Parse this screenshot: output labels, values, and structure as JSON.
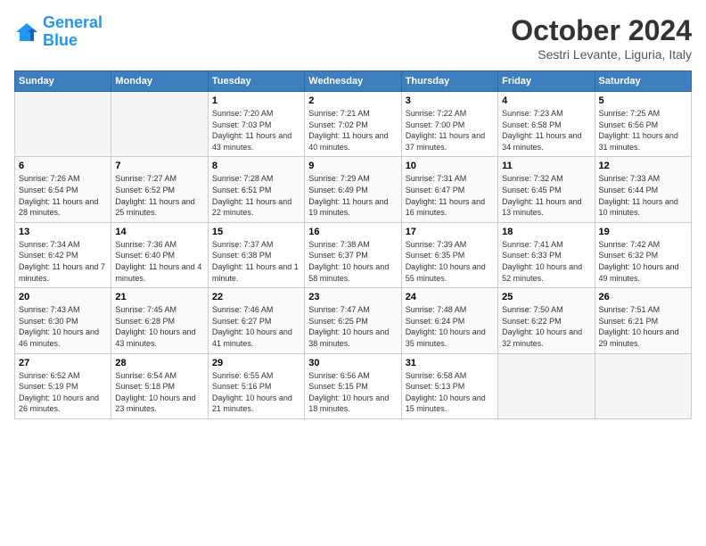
{
  "logo": {
    "line1": "General",
    "line2": "Blue"
  },
  "title": "October 2024",
  "subtitle": "Sestri Levante, Liguria, Italy",
  "headers": [
    "Sunday",
    "Monday",
    "Tuesday",
    "Wednesday",
    "Thursday",
    "Friday",
    "Saturday"
  ],
  "weeks": [
    [
      {
        "day": "",
        "info": ""
      },
      {
        "day": "",
        "info": ""
      },
      {
        "day": "1",
        "info": "Sunrise: 7:20 AM\nSunset: 7:03 PM\nDaylight: 11 hours and 43 minutes."
      },
      {
        "day": "2",
        "info": "Sunrise: 7:21 AM\nSunset: 7:02 PM\nDaylight: 11 hours and 40 minutes."
      },
      {
        "day": "3",
        "info": "Sunrise: 7:22 AM\nSunset: 7:00 PM\nDaylight: 11 hours and 37 minutes."
      },
      {
        "day": "4",
        "info": "Sunrise: 7:23 AM\nSunset: 6:58 PM\nDaylight: 11 hours and 34 minutes."
      },
      {
        "day": "5",
        "info": "Sunrise: 7:25 AM\nSunset: 6:56 PM\nDaylight: 11 hours and 31 minutes."
      }
    ],
    [
      {
        "day": "6",
        "info": "Sunrise: 7:26 AM\nSunset: 6:54 PM\nDaylight: 11 hours and 28 minutes."
      },
      {
        "day": "7",
        "info": "Sunrise: 7:27 AM\nSunset: 6:52 PM\nDaylight: 11 hours and 25 minutes."
      },
      {
        "day": "8",
        "info": "Sunrise: 7:28 AM\nSunset: 6:51 PM\nDaylight: 11 hours and 22 minutes."
      },
      {
        "day": "9",
        "info": "Sunrise: 7:29 AM\nSunset: 6:49 PM\nDaylight: 11 hours and 19 minutes."
      },
      {
        "day": "10",
        "info": "Sunrise: 7:31 AM\nSunset: 6:47 PM\nDaylight: 11 hours and 16 minutes."
      },
      {
        "day": "11",
        "info": "Sunrise: 7:32 AM\nSunset: 6:45 PM\nDaylight: 11 hours and 13 minutes."
      },
      {
        "day": "12",
        "info": "Sunrise: 7:33 AM\nSunset: 6:44 PM\nDaylight: 11 hours and 10 minutes."
      }
    ],
    [
      {
        "day": "13",
        "info": "Sunrise: 7:34 AM\nSunset: 6:42 PM\nDaylight: 11 hours and 7 minutes."
      },
      {
        "day": "14",
        "info": "Sunrise: 7:36 AM\nSunset: 6:40 PM\nDaylight: 11 hours and 4 minutes."
      },
      {
        "day": "15",
        "info": "Sunrise: 7:37 AM\nSunset: 6:38 PM\nDaylight: 11 hours and 1 minute."
      },
      {
        "day": "16",
        "info": "Sunrise: 7:38 AM\nSunset: 6:37 PM\nDaylight: 10 hours and 58 minutes."
      },
      {
        "day": "17",
        "info": "Sunrise: 7:39 AM\nSunset: 6:35 PM\nDaylight: 10 hours and 55 minutes."
      },
      {
        "day": "18",
        "info": "Sunrise: 7:41 AM\nSunset: 6:33 PM\nDaylight: 10 hours and 52 minutes."
      },
      {
        "day": "19",
        "info": "Sunrise: 7:42 AM\nSunset: 6:32 PM\nDaylight: 10 hours and 49 minutes."
      }
    ],
    [
      {
        "day": "20",
        "info": "Sunrise: 7:43 AM\nSunset: 6:30 PM\nDaylight: 10 hours and 46 minutes."
      },
      {
        "day": "21",
        "info": "Sunrise: 7:45 AM\nSunset: 6:28 PM\nDaylight: 10 hours and 43 minutes."
      },
      {
        "day": "22",
        "info": "Sunrise: 7:46 AM\nSunset: 6:27 PM\nDaylight: 10 hours and 41 minutes."
      },
      {
        "day": "23",
        "info": "Sunrise: 7:47 AM\nSunset: 6:25 PM\nDaylight: 10 hours and 38 minutes."
      },
      {
        "day": "24",
        "info": "Sunrise: 7:48 AM\nSunset: 6:24 PM\nDaylight: 10 hours and 35 minutes."
      },
      {
        "day": "25",
        "info": "Sunrise: 7:50 AM\nSunset: 6:22 PM\nDaylight: 10 hours and 32 minutes."
      },
      {
        "day": "26",
        "info": "Sunrise: 7:51 AM\nSunset: 6:21 PM\nDaylight: 10 hours and 29 minutes."
      }
    ],
    [
      {
        "day": "27",
        "info": "Sunrise: 6:52 AM\nSunset: 5:19 PM\nDaylight: 10 hours and 26 minutes."
      },
      {
        "day": "28",
        "info": "Sunrise: 6:54 AM\nSunset: 5:18 PM\nDaylight: 10 hours and 23 minutes."
      },
      {
        "day": "29",
        "info": "Sunrise: 6:55 AM\nSunset: 5:16 PM\nDaylight: 10 hours and 21 minutes."
      },
      {
        "day": "30",
        "info": "Sunrise: 6:56 AM\nSunset: 5:15 PM\nDaylight: 10 hours and 18 minutes."
      },
      {
        "day": "31",
        "info": "Sunrise: 6:58 AM\nSunset: 5:13 PM\nDaylight: 10 hours and 15 minutes."
      },
      {
        "day": "",
        "info": ""
      },
      {
        "day": "",
        "info": ""
      }
    ]
  ]
}
